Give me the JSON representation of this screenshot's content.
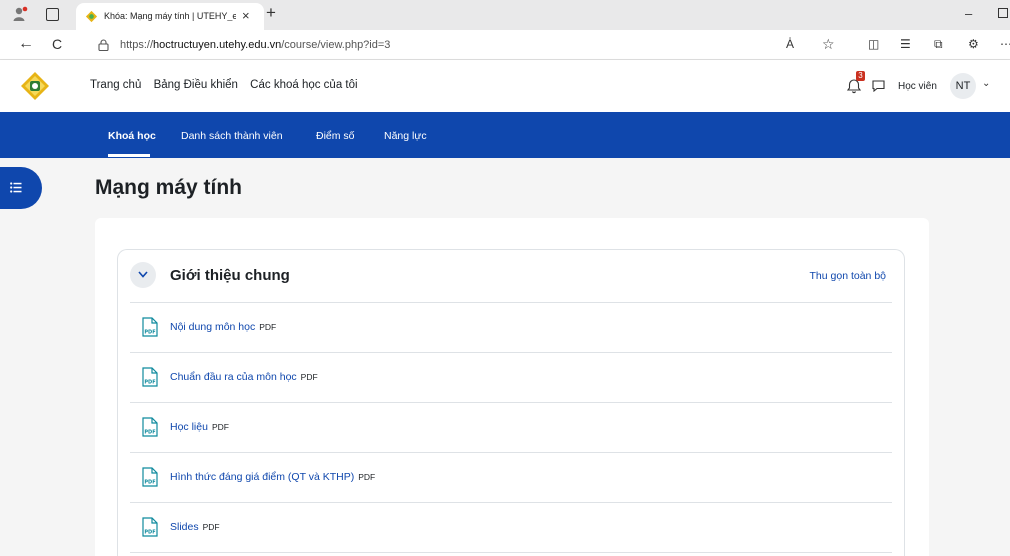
{
  "browser": {
    "tab_title": "Khóa: Mạng máy tính | UTEHY_el",
    "tab_close": "×",
    "new_tab": "+",
    "minimize": "–",
    "url_prefix": "https://",
    "url_host": "hoctructuyen.utehy.edu.vn",
    "url_path": "/course/view.php?id=3",
    "back": "←",
    "reload": "C"
  },
  "navbar": {
    "links": [
      "Trang chủ",
      "Bảng Điều khiển",
      "Các khoá học của tôi"
    ],
    "notification_count": "3",
    "role": "Học viên",
    "avatar_initials": "NT",
    "caret": "⌄"
  },
  "secondary_nav": {
    "items": [
      "Khoá học",
      "Danh sách thành viên",
      "Điểm số",
      "Năng lực"
    ],
    "active_index": 0
  },
  "course": {
    "title": "Mạng máy tính"
  },
  "section": {
    "title": "Giới thiệu chung",
    "collapse_all": "Thu gọn toàn bộ",
    "activities": [
      {
        "name": "Nội dung môn học",
        "type": "PDF"
      },
      {
        "name": "Chuẩn đầu ra của môn học",
        "type": "PDF"
      },
      {
        "name": "Học liệu",
        "type": "PDF"
      },
      {
        "name": "Hình thức đáng giá điểm (QT và KTHP)",
        "type": "PDF"
      },
      {
        "name": "Slides",
        "type": "PDF"
      }
    ]
  },
  "icons": {
    "pdf_file": "pdf-file-icon",
    "bell": "bell-icon",
    "chat": "chat-icon",
    "drawer": "list-icon"
  },
  "colors": {
    "primary": "#0f47ad",
    "pdf_icon": "#0f8a9d",
    "badge": "#ca3120"
  }
}
